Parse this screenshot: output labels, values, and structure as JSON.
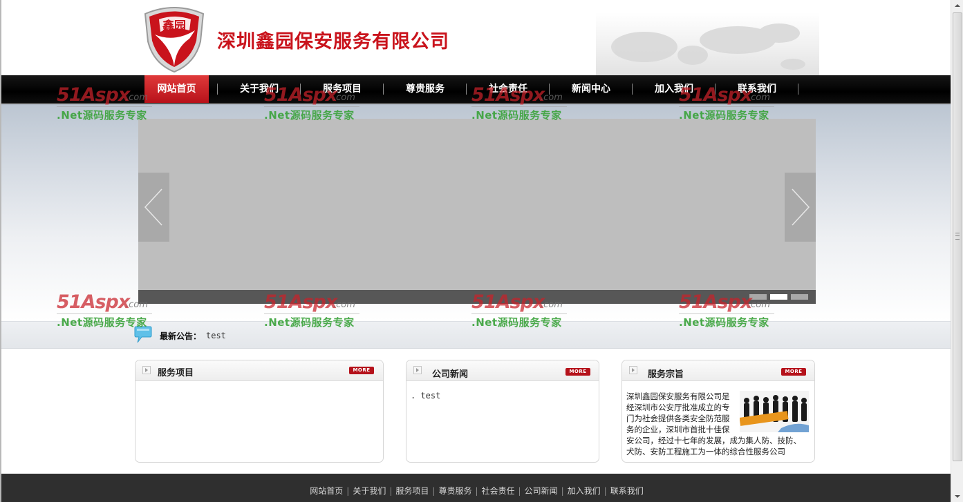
{
  "header": {
    "logo_text": "鑫园",
    "company_name": "深圳鑫园保安服务有限公司"
  },
  "nav": {
    "items": [
      {
        "label": "网站首页",
        "active": true
      },
      {
        "label": "关于我们"
      },
      {
        "label": "服务项目"
      },
      {
        "label": "尊贵服务"
      },
      {
        "label": "社会责任"
      },
      {
        "label": "新闻中心"
      },
      {
        "label": "加入我们"
      },
      {
        "label": "联系我们"
      }
    ]
  },
  "slider": {
    "active_dot": 2,
    "dot_count": 3
  },
  "notice": {
    "label": "最新公告：",
    "text": "test"
  },
  "boxes": {
    "services": {
      "title": "服务项目",
      "more": "MORE"
    },
    "news": {
      "title": "公司新闻",
      "more": "MORE",
      "items": [
        ". test"
      ]
    },
    "purpose": {
      "title": "服务宗旨",
      "more": "MORE",
      "text": "深圳鑫园保安服务有限公司是经深圳市公安厅批准成立的专门为社会提供各类安全防范服务的企业，深圳市首批十佳保安公司，经过十七年的发展，成为集人防、技防、犬防、安防工程施工为一体的综合性服务公司"
    }
  },
  "footer": {
    "links": [
      "网站首页",
      "关于我们",
      "服务项目",
      "尊贵服务",
      "社会责任",
      "公司新闻",
      "加入我们",
      "联系我们"
    ]
  },
  "watermark": {
    "brand": "51Aspx",
    "com": ".com",
    "slogan": ".Net源码服务专家"
  },
  "colors": {
    "brand_red": "#c9131c",
    "nav_bg": "#000000",
    "active_red": "#c8161e",
    "footer_bg": "#2f2f2f",
    "watermark_green": "#3aa33a"
  }
}
